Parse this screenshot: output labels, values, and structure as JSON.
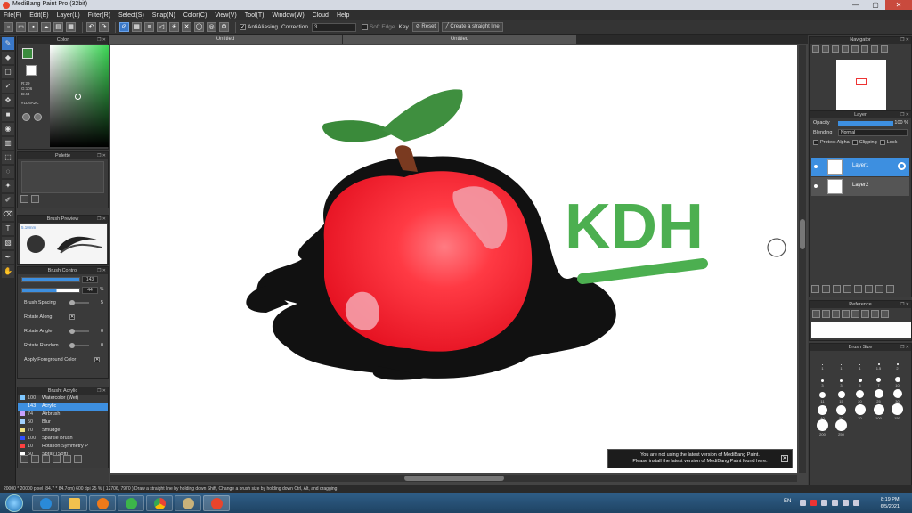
{
  "window": {
    "title": "MediBang Paint Pro (32bit)",
    "controls": {
      "minimize": "—",
      "maximize": "▢",
      "close": "✕"
    }
  },
  "menu": [
    "File(F)",
    "Edit(E)",
    "Layer(L)",
    "Filter(R)",
    "Select(S)",
    "Snap(N)",
    "Color(C)",
    "View(V)",
    "Tool(T)",
    "Window(W)",
    "Cloud",
    "Help"
  ],
  "toolbar": {
    "antialiasing": "AntiAliasing",
    "correction_label": "Correction",
    "correction_value": "3",
    "soft_edge": "Soft Edge",
    "key_label": "Key",
    "reset": "Reset",
    "straight_line": "Create a straight line"
  },
  "tabs": [
    "Untitled",
    "Untitled"
  ],
  "panels": {
    "color": {
      "title": "Color",
      "rgb": [
        "R:29",
        "G:106",
        "B:44"
      ],
      "hex": "#1D6A2C"
    },
    "palette": {
      "title": "Palette"
    },
    "brush_preview": {
      "title": "Brush Preview",
      "size": "5.10mm"
    },
    "brush_control": {
      "title": "Brush Control",
      "size_value": "143",
      "size_unit": "",
      "opacity_value": "44",
      "opacity_unit": "%",
      "options": [
        {
          "label": "Brush Spacing",
          "value": "5"
        },
        {
          "label": "Rotate Along",
          "value": "✕"
        },
        {
          "label": "Rotate Angle",
          "value": "0"
        },
        {
          "label": "Rotate Random",
          "value": "0"
        },
        {
          "label": "Apply Foreground Color",
          "value": "✕"
        }
      ]
    },
    "brush_list": {
      "title": "Brush: Acrylic",
      "items": [
        {
          "num": "100",
          "name": "Watercolor (Wet)",
          "color": "#7ec8ff"
        },
        {
          "num": "143",
          "name": "Acrylic",
          "color": "#3d8fe0",
          "selected": true
        },
        {
          "num": "74",
          "name": "Airbrush",
          "color": "#c8a2ff"
        },
        {
          "num": "50",
          "name": "Blur",
          "color": "#a0d0ff"
        },
        {
          "num": "70",
          "name": "Smudge",
          "color": "#f0e080"
        },
        {
          "num": "100",
          "name": "Sparkle Brush",
          "color": "#3050ff"
        },
        {
          "num": "10",
          "name": "Rotation Symmetry P",
          "color": "#ff4040"
        },
        {
          "num": "50",
          "name": "Spray (Soft)",
          "color": "#ffffff"
        }
      ]
    },
    "navigator": {
      "title": "Navigator"
    },
    "layer": {
      "title": "Layer",
      "opacity_label": "Opacity",
      "opacity_value": "100 %",
      "blending_label": "Blending",
      "blending_value": "Normal",
      "protect_alpha": "Protect Alpha",
      "clipping": "Clipping",
      "lock": "Lock",
      "layers": [
        {
          "name": "Layer1",
          "selected": true
        },
        {
          "name": "Layer2",
          "selected": false
        }
      ]
    },
    "reference": {
      "title": "Reference"
    },
    "brush_size": {
      "title": "Brush Size",
      "sizes": [
        "1",
        "1",
        "1",
        "1.5",
        "2",
        "3",
        "3",
        "5",
        "7",
        "10",
        "11",
        "15",
        "20",
        "25",
        "30",
        "40",
        "50",
        "70",
        "100",
        "150",
        "200",
        "250"
      ]
    }
  },
  "canvas": {
    "handwriting": "KDH",
    "notice_line1": "You are not using the latest version of MediBang Paint.",
    "notice_line2": "Please install the latest version of MediBang Paint found here.",
    "notice_close": "✕"
  },
  "status": "20000 * 20000 pixel  (84.7 * 84.7cm)  600 dpi  25 %  ( 12706, 7970 )  Draw a straight line by holding down Shift, Change a brush size by holding down Ctrl, Alt, and dragging",
  "taskbar": {
    "lang": "EN",
    "time": "8:19 PM",
    "date": "6/5/2021"
  },
  "colors": {
    "accent": "#3d8fe0",
    "fg_color": "#3b8c3e",
    "apple_red": "#f0232e",
    "leaf_green": "#3a8a3a",
    "ink_green": "#4caf50"
  }
}
